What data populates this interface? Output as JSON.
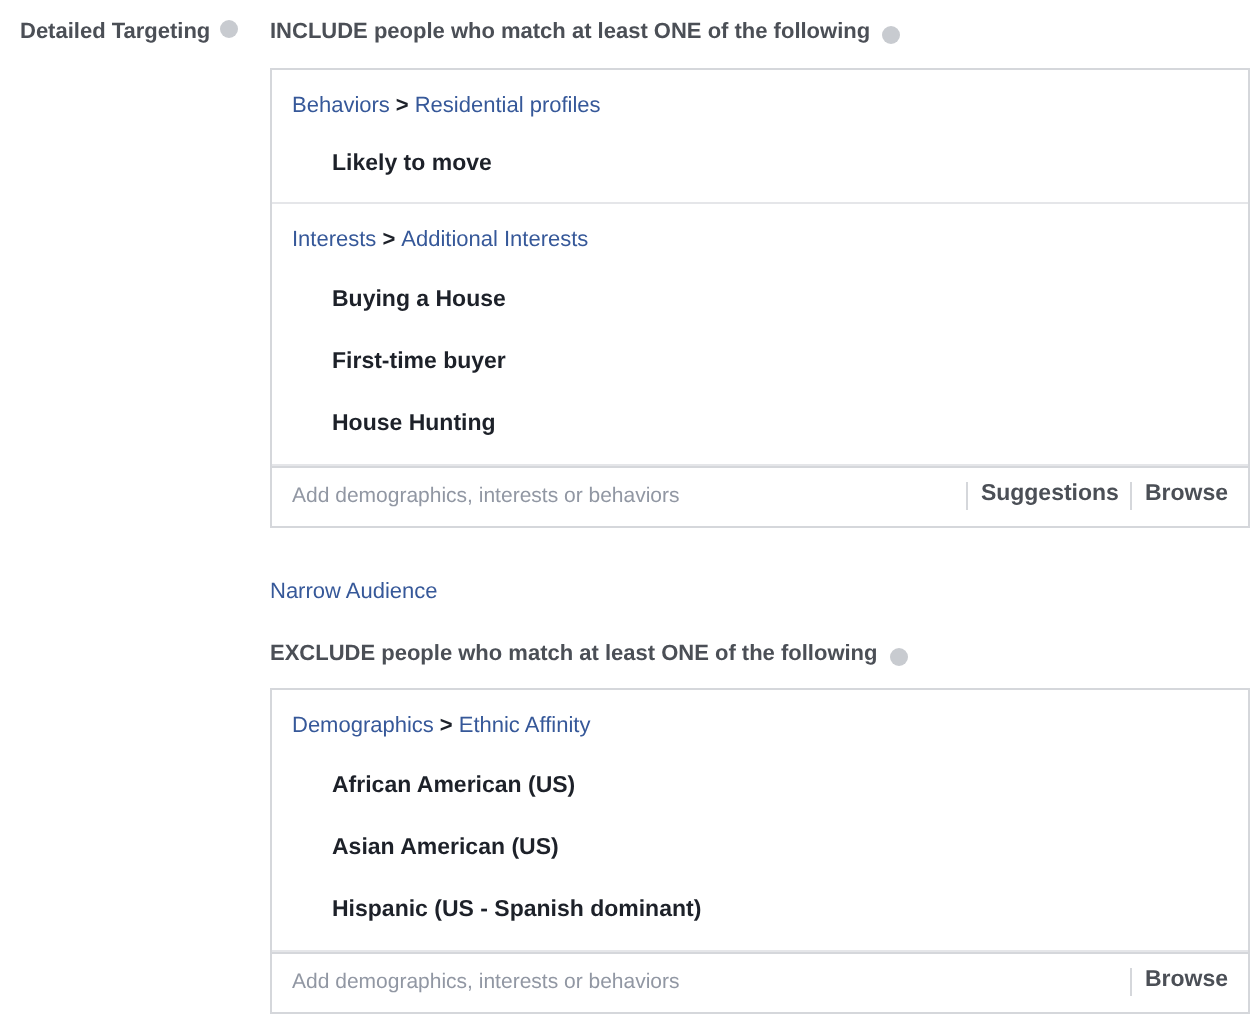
{
  "label": "Detailed Targeting",
  "include": {
    "heading": "INCLUDE people who match at least ONE of the following",
    "groups": [
      {
        "category": "Behaviors",
        "separator": ">",
        "subcategory": "Residential profiles",
        "items": [
          "Likely to move"
        ]
      },
      {
        "category": "Interests",
        "separator": ">",
        "subcategory": "Additional Interests",
        "items": [
          "Buying a House",
          "First-time buyer",
          "House Hunting"
        ]
      }
    ],
    "search": {
      "placeholder": "Add demographics, interests or behaviors"
    },
    "actions": [
      "Suggestions",
      "Browse"
    ]
  },
  "narrow_link": "Narrow Audience",
  "exclude": {
    "heading": "EXCLUDE people who match at least ONE of the following",
    "groups": [
      {
        "category": "Demographics",
        "separator": ">",
        "subcategory": "Ethnic Affinity",
        "items": [
          "African American (US)",
          "Asian American (US)",
          "Hispanic (US - Spanish dominant)"
        ]
      }
    ],
    "search": {
      "placeholder": "Add demographics, interests or behaviors"
    },
    "actions": [
      "Browse"
    ]
  }
}
